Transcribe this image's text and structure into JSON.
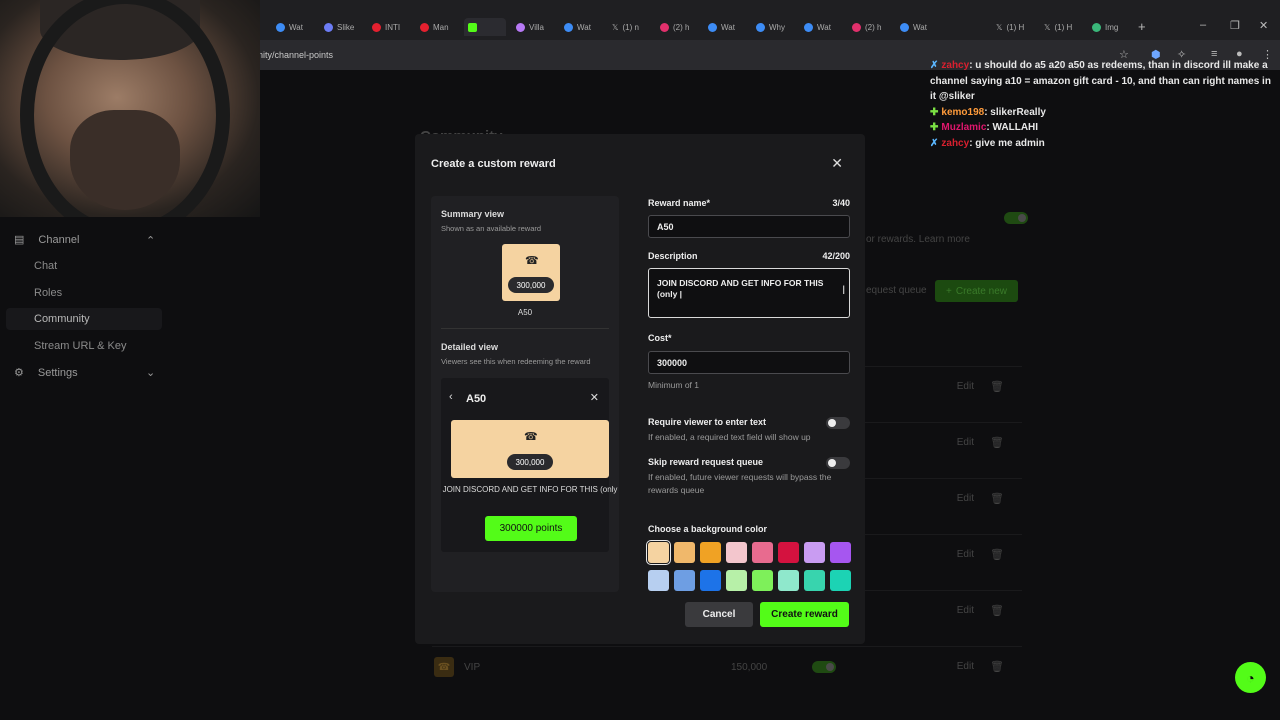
{
  "browser": {
    "tabs": [
      "Wat",
      "Slike",
      "INTI",
      "Man",
      "",
      "Villa",
      "Wat",
      "(1) n",
      "(2) h",
      "Wat",
      "Why",
      "Wat",
      "(2) h",
      "Wat",
      "(1) H",
      "(1) H",
      "Img"
    ],
    "address": "nity/channel-points"
  },
  "sidebar": {
    "channel_label": "Channel",
    "items": [
      "Chat",
      "Roles",
      "Community",
      "Stream URL & Key"
    ],
    "settings_label": "Settings"
  },
  "background": {
    "page_title": "Community",
    "learn_more": "or rewards. Learn more",
    "request_queue": "equest queue",
    "create_new": "Create new",
    "edit_label": "Edit",
    "vip_name": "VIP",
    "vip_cost": "150,000"
  },
  "chat": {
    "messages": [
      {
        "user": "zahcy",
        "text": ": u should do a5 a20 a50 as redeems, than in discord ill make a channel saying a10 = amazon gift card - 10, and than can right names in it @sliker"
      },
      {
        "user": "kemo198",
        "text": ": slikerReally"
      },
      {
        "user": "Muzlamic",
        "text": ": WALLAHI"
      },
      {
        "user": "zahcy",
        "text": ": give me admin"
      }
    ]
  },
  "modal": {
    "title": "Create a custom reward",
    "summary_title": "Summary view",
    "summary_sub": "Shown as an available reward",
    "detailed_title": "Detailed view",
    "detailed_sub": "Viewers see this when redeeming the reward",
    "reward_name_label": "Reward name*",
    "reward_name_count": "3/40",
    "reward_name_value": "A50",
    "description_label": "Description",
    "description_count": "42/200",
    "description_value": "JOIN DISCORD AND GET INFO FOR THIS (only |",
    "preview_description": "JOIN DISCORD AND GET INFO FOR THIS (only",
    "cost_label": "Cost*",
    "cost_value": "300000",
    "cost_hint": "Minimum of 1",
    "cost_display": "300,000",
    "points_button": "300000 points",
    "require_text_label": "Require viewer to enter text",
    "require_text_hint": "If enabled, a required text field will show up",
    "skip_queue_label": "Skip reward request queue",
    "skip_queue_hint": "If enabled, future viewer requests will bypass the rewards queue",
    "bg_color_label": "Choose a background color",
    "cancel_label": "Cancel",
    "create_label": "Create reward",
    "colors": [
      "#f5d3a1",
      "#f0b86b",
      "#f0a224",
      "#f3c6cd",
      "#e86b8f",
      "#d4123f",
      "#c99cf2",
      "#a656f0",
      "#b7cff0",
      "#6e9ee3",
      "#1d73e8",
      "#b7f0a8",
      "#7ef05a",
      "#8fe8cc",
      "#38d4ae",
      "#1cd3b4"
    ],
    "selected_color": "#f5d3a1"
  }
}
